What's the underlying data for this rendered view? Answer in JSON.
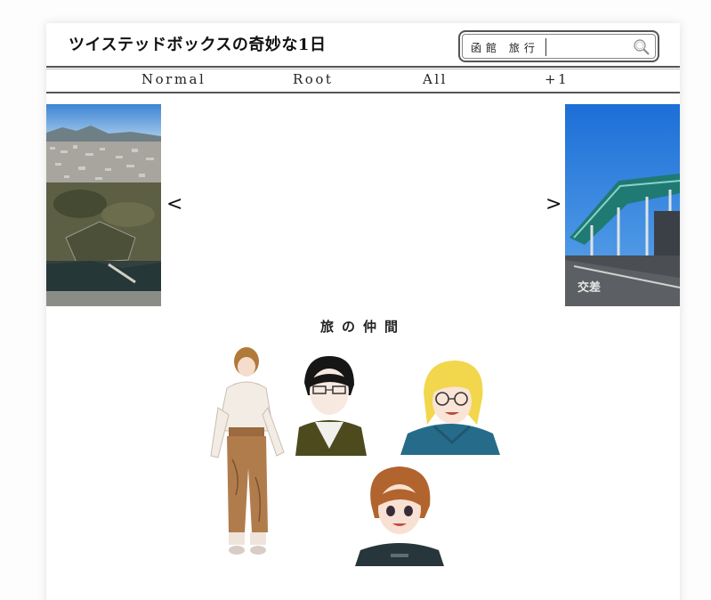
{
  "header": {
    "site_title": "ツイステッドボックスの奇妙な1日",
    "search_value": "函館 旅行",
    "search_icon": "magnifier-icon"
  },
  "nav": {
    "tabs": [
      {
        "label": "Normal"
      },
      {
        "label": "Root"
      },
      {
        "label": "All"
      },
      {
        "label": "+1"
      }
    ]
  },
  "carousel": {
    "prev_label": "<",
    "next_label": ">"
  },
  "section": {
    "title": "旅の仲間"
  }
}
